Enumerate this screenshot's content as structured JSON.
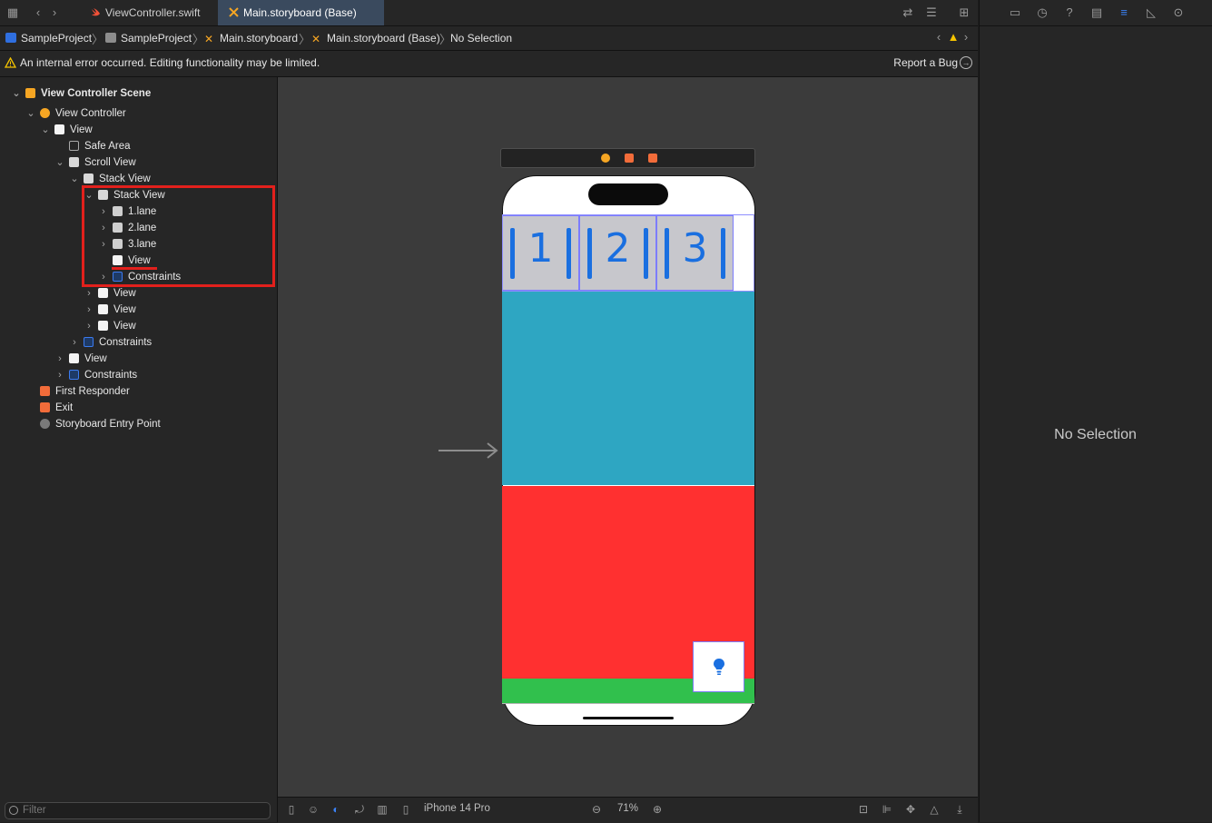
{
  "tabs": [
    {
      "label": "ViewController.swift",
      "icon": "swift-file-icon",
      "active": false
    },
    {
      "label": "Main.storyboard (Base)",
      "icon": "storyboard-file-icon",
      "active": true
    }
  ],
  "breadcrumb": [
    {
      "label": "SampleProject",
      "icon": "project-icon"
    },
    {
      "label": "SampleProject",
      "icon": "folder-icon"
    },
    {
      "label": "Main.storyboard",
      "icon": "storyboard-icon"
    },
    {
      "label": "Main.storyboard (Base)",
      "icon": "storyboard-icon"
    },
    {
      "label": "No Selection",
      "icon": ""
    }
  ],
  "warning": {
    "message": "An internal error occurred. Editing functionality may be limited.",
    "report_label": "Report a Bug"
  },
  "outline": {
    "scene": "View Controller Scene",
    "view_controller": "View Controller",
    "view": "View",
    "safe_area": "Safe Area",
    "scroll_view": "Scroll View",
    "outer_stack": "Stack View",
    "inner_stack": "Stack View",
    "lanes": [
      "1.lane",
      "2.lane",
      "3.lane"
    ],
    "inner_view": "View",
    "inner_constraints": "Constraints",
    "views": [
      "View",
      "View",
      "View"
    ],
    "stack_constraints": "Constraints",
    "bottom_view": "View",
    "view_constraints": "Constraints",
    "first_responder": "First Responder",
    "exit": "Exit",
    "entry_point": "Storyboard Entry Point"
  },
  "filter": {
    "placeholder": "Filter"
  },
  "canvas": {
    "lane_labels": [
      "1",
      "2",
      "3"
    ],
    "colors": {
      "blue": "#2ea6c2",
      "red": "#ff3030",
      "green": "#31c04d",
      "lane": "#c7c7cc"
    }
  },
  "canvas_toolbar": {
    "device": "iPhone 14 Pro",
    "zoom": "71%"
  },
  "inspector": {
    "empty_label": "No Selection"
  }
}
